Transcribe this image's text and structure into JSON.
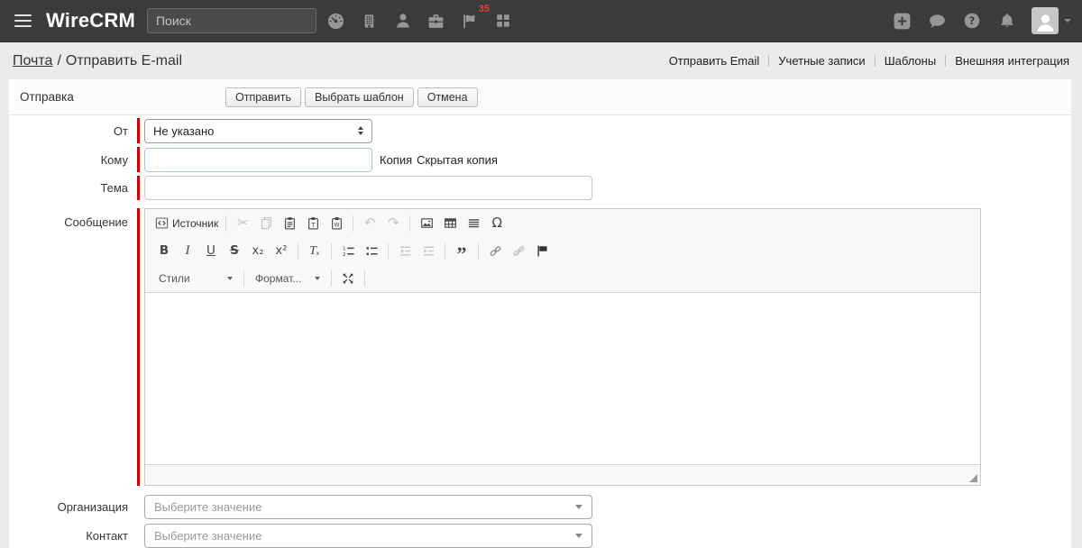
{
  "navbar": {
    "brand": "WireCRM",
    "search_placeholder": "Поиск",
    "tasks_badge": "35"
  },
  "breadcrumb": {
    "section": "Почта",
    "separator": "/",
    "page": "Отправить E-mail"
  },
  "header_links": [
    "Отправить Email",
    "Учетные записи",
    "Шаблоны",
    "Внешняя интеграция"
  ],
  "form": {
    "section_label": "Отправка",
    "send_button": "Отправить",
    "template_button": "Выбрать шаблон",
    "cancel_button": "Отмена",
    "from_label": "От",
    "from_value": "Не указано",
    "to_label": "Кому",
    "to_value": "",
    "cc_link": "Копия",
    "bcc_link": "Скрытая копия",
    "subject_label": "Тема",
    "subject_value": "",
    "message_label": "Сообщение",
    "organization_label": "Организация",
    "organization_placeholder": "Выберите значение",
    "contact_label": "Контакт",
    "contact_placeholder": "Выберите значение"
  },
  "editor": {
    "source_label": "Источник",
    "styles_label": "Стили",
    "format_label": "Формат...",
    "glyphs": {
      "cut": "✂",
      "undo": "↶",
      "redo": "↷",
      "omega": "Ω",
      "quote": "”",
      "bold": "B",
      "italic": "I",
      "underline": "U",
      "strike": "S",
      "subscript": "x₂",
      "superscript": "x²",
      "remove_format": "Tₓ"
    }
  },
  "colors": {
    "navbar_bg": "#3b3b3b",
    "required_red": "#cc0000",
    "badge_red": "#e8432e"
  }
}
